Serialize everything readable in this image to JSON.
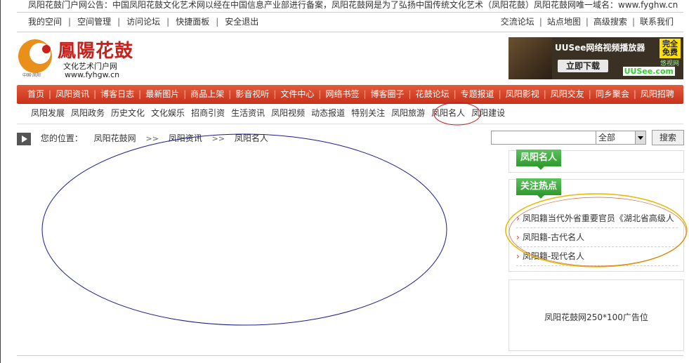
{
  "notice": "凤阳花鼓门户网公告：中国凤阳花鼓文化艺术网以经在中国信息产业部进行备案，凤阳花鼓网是为了弘扬中国传统文化艺术（凤阳花鼓）凤阳花鼓网唯一域名：www.fyghw.cn",
  "topbar": {
    "left": [
      "我的空间",
      "空间管理",
      "访问论坛",
      "快捷面板",
      "安全退出"
    ],
    "right": [
      "交流论坛",
      "站点地图",
      "高级搜索",
      "联系我们"
    ]
  },
  "logo": {
    "title": "鳳陽花鼓",
    "subtitle": "文化艺术门户网",
    "url": "www.fyhgw.cn",
    "small": "中国·凤阳"
  },
  "banner": {
    "title": "UUSee网络视频播放器",
    "badge": "完全免费",
    "download": "立即下载",
    "brand": "UUSee.com",
    "tag": "悠视网"
  },
  "mainnav": [
    "首页",
    "凤阳资讯",
    "博客日志",
    "最新图片",
    "商品上架",
    "影音视听",
    "文件中心",
    "网络书签",
    "博客圈子",
    "花鼓论坛",
    "专题报道",
    "凤阳影视",
    "凤阳交友",
    "同乡聚会",
    "凤阳招聘"
  ],
  "subnav": [
    "凤阳发展",
    "凤阳政务",
    "历史文化",
    "文化娱乐",
    "招商引资",
    "生活资讯",
    "凤阳视频",
    "动态报道",
    "特别关注",
    "凤阳旅游",
    "凤阳名人",
    "凤阳建设"
  ],
  "breadcrumb": {
    "label": "您的位置：",
    "items": [
      "凤阳花鼓网",
      "凤阳资讯",
      "凤阳名人"
    ],
    "sep": ">>"
  },
  "search": {
    "value": "",
    "select": "全部",
    "button": "搜索"
  },
  "sidebar": {
    "box1_title": "凤阳名人",
    "box2_title": "关注热点",
    "hot": [
      "凤阳籍当代外省重要官员《湖北省高级人",
      "凤阳籍-古代名人",
      "凤阳籍-现代名人"
    ],
    "ad": "凤阳花鼓网250*100广告位"
  },
  "colors": {
    "nav_red": "#d8402a",
    "green_tab": "#3aa83a",
    "annotation_blue": "#1a1a8c",
    "annotation_yellow": "#e6b800",
    "annotation_red": "#c02020"
  }
}
